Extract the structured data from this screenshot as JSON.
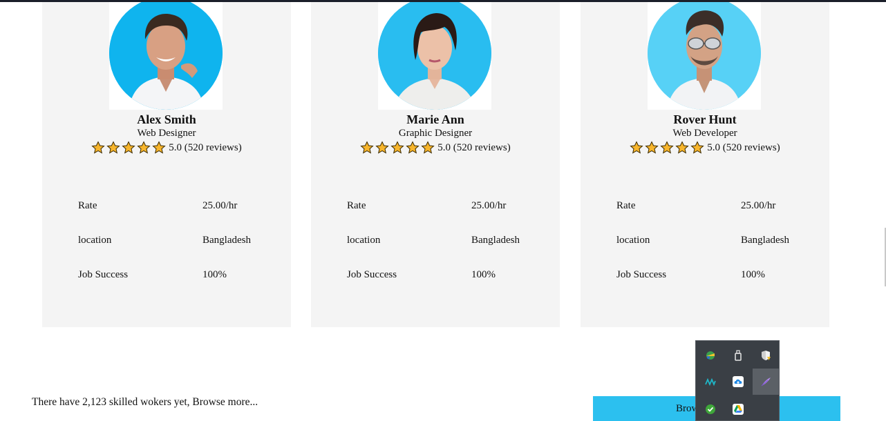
{
  "cards": [
    {
      "name": "Alex Smith",
      "role": "Web Designer",
      "rating": "5.0 (520 reviews)",
      "details": [
        {
          "label": "Rate",
          "value": "25.00/hr"
        },
        {
          "label": "location",
          "value": "Bangladesh"
        },
        {
          "label": "Job Success",
          "value": "100%"
        }
      ]
    },
    {
      "name": "Marie Ann",
      "role": "Graphic Designer",
      "rating": "5.0 (520 reviews)",
      "details": [
        {
          "label": "Rate",
          "value": "25.00/hr"
        },
        {
          "label": "location",
          "value": "Bangladesh"
        },
        {
          "label": "Job Success",
          "value": "100%"
        }
      ]
    },
    {
      "name": "Rover Hunt",
      "role": "Web Developer",
      "rating": "5.0 (520 reviews)",
      "details": [
        {
          "label": "Rate",
          "value": "25.00/hr"
        },
        {
          "label": "location",
          "value": "Bangladesh"
        },
        {
          "label": "Job Success",
          "value": "100%"
        }
      ]
    }
  ],
  "star_rating": 5,
  "footer": {
    "text": "There have 2,123 skilled wokers yet, Browse more...",
    "button_label": "Brow"
  },
  "colors": {
    "accent": "#2cc0ef",
    "avatar_bg": "#1cb5ee",
    "card_bg": "#f4f4f4",
    "star": "#f7b52c"
  },
  "tray_icons": [
    "network-icon",
    "usb-drive-icon",
    "security-shield-icon",
    "wave-app-icon",
    "cloud-upload-icon",
    "feather-app-icon",
    "check-shield-icon",
    "google-drive-icon"
  ]
}
